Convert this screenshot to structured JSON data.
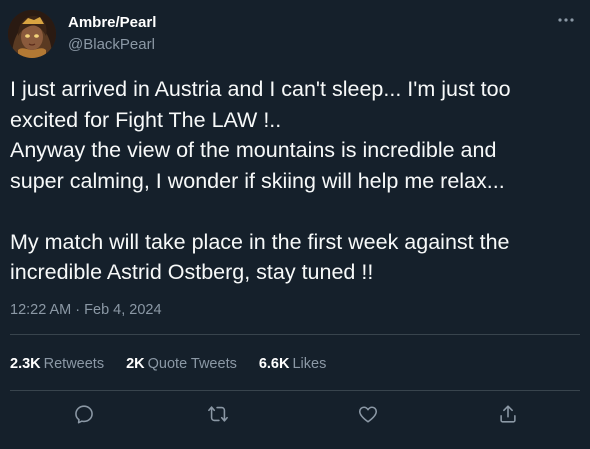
{
  "author": {
    "display_name": "Ambre/Pearl",
    "handle": "@BlackPearl"
  },
  "tweet": {
    "lines": [
      "I just arrived in Austria and I can't sleep... I'm just too",
      "excited for Fight The LAW !..",
      "Anyway the view of the mountains is incredible and",
      "super calming, I wonder if skiing will help me relax...",
      "",
      "My match will take place in the first week against the",
      "incredible Astrid Ostberg, stay tuned !!"
    ],
    "time": "12:22 AM",
    "separator": " · ",
    "date": "Feb 4, 2024"
  },
  "stats": {
    "retweets_count": "2.3K",
    "retweets_label": "Retweets",
    "quotes_count": "2K",
    "quotes_label": "Quote Tweets",
    "likes_count": "6.6K",
    "likes_label": "Likes"
  },
  "colors": {
    "background": "#15202b",
    "text": "#f7f9f9",
    "secondary": "#8b98a5",
    "divider": "#38444d"
  },
  "icons": {
    "more": "more-horizontal-icon",
    "reply": "reply-icon",
    "retweet": "retweet-icon",
    "like": "heart-icon",
    "share": "share-icon"
  }
}
